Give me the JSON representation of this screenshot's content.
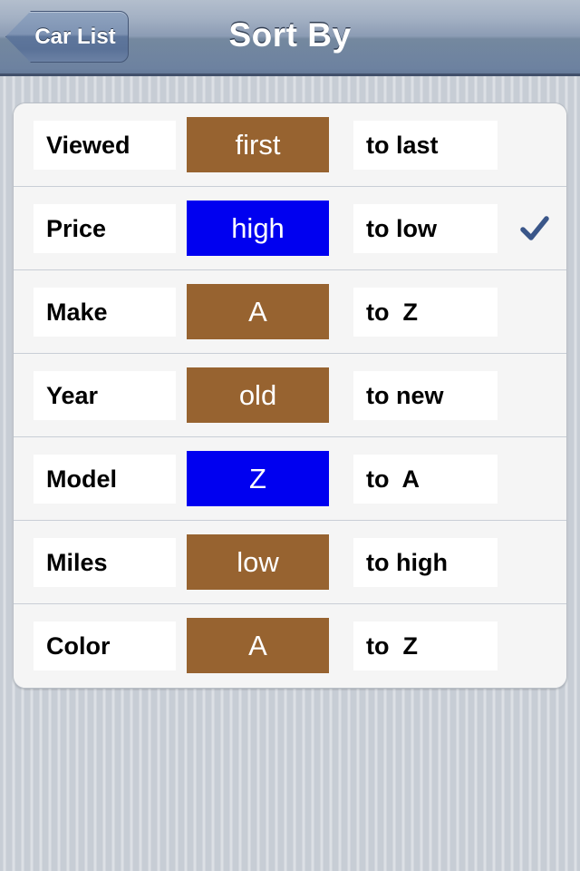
{
  "navbar": {
    "back_label": "Car List",
    "title": "Sort By"
  },
  "sort_options": [
    {
      "label": "Viewed",
      "badge": "first",
      "badge_color": "brown",
      "tail": "to last",
      "selected": false
    },
    {
      "label": "Price",
      "badge": "high",
      "badge_color": "blue",
      "tail": "to low",
      "selected": true
    },
    {
      "label": "Make",
      "badge": "A",
      "badge_color": "brown",
      "tail": "to  Z",
      "selected": false
    },
    {
      "label": "Year",
      "badge": "old",
      "badge_color": "brown",
      "tail": "to new",
      "selected": false
    },
    {
      "label": "Model",
      "badge": "Z",
      "badge_color": "blue",
      "tail": "to  A",
      "selected": false
    },
    {
      "label": "Miles",
      "badge": "low",
      "badge_color": "brown",
      "tail": "to high",
      "selected": false
    },
    {
      "label": "Color",
      "badge": "A",
      "badge_color": "brown",
      "tail": "to  Z",
      "selected": false
    }
  ],
  "icons": {
    "checkmark": "checkmark-icon",
    "back_arrow": "back-arrow-icon"
  },
  "colors": {
    "badge_brown": "#976330",
    "badge_blue": "#0000f0",
    "checkmark": "#3a5689",
    "navbar_top": "#b3becd",
    "navbar_bottom": "#667b9a",
    "page_background": "#c7cdd5",
    "row_background": "#f5f5f5"
  }
}
